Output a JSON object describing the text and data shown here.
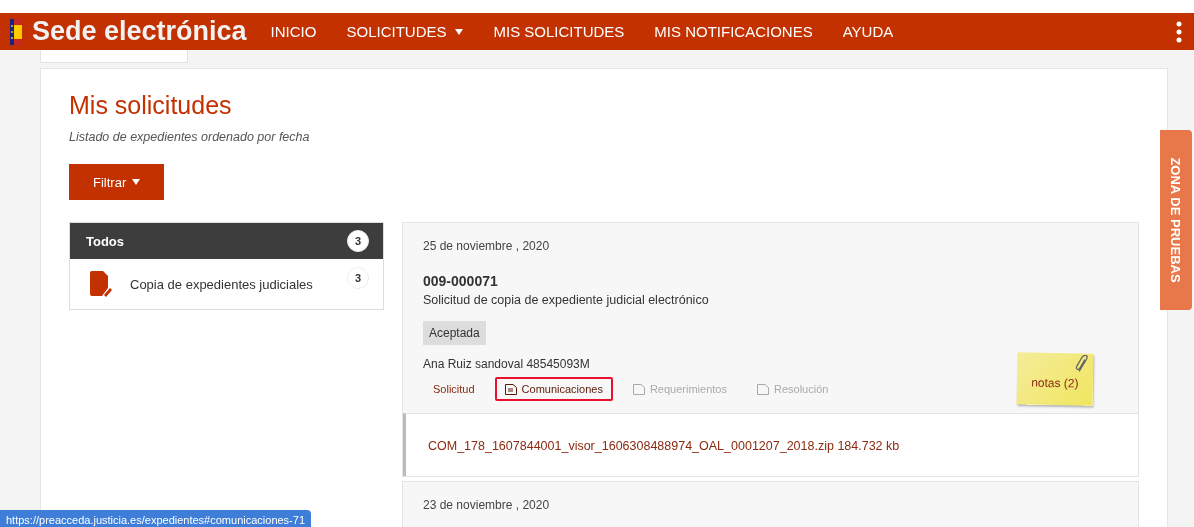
{
  "header": {
    "title": "Sede electrónica",
    "nav": [
      {
        "label": "INICIO",
        "dropdown": false
      },
      {
        "label": "SOLICITUDES",
        "dropdown": true
      },
      {
        "label": "MIS SOLICITUDES",
        "dropdown": false
      },
      {
        "label": "MIS NOTIFICACIONES",
        "dropdown": false
      },
      {
        "label": "AYUDA",
        "dropdown": false
      }
    ]
  },
  "page": {
    "title": "Mis solicitudes",
    "subtitle": "Listado de expedientes ordenado por fecha",
    "filter_button": "Filtrar"
  },
  "sidebar": {
    "items": [
      {
        "label": "Todos",
        "count": "3",
        "selected": true
      },
      {
        "label": "Copia de expedientes judiciales",
        "count": "3",
        "selected": false
      }
    ]
  },
  "records": [
    {
      "date": "25 de noviembre , 2020",
      "number": "009-000071",
      "description": "Solicitud de copia de expediente judicial electrónico",
      "status": "Aceptada",
      "applicant": "Ana Ruiz sandoval 48545093M",
      "notes": "notas (2)",
      "tabs": [
        {
          "label": "Solicitud",
          "icon": false,
          "selected": false,
          "disabled": false
        },
        {
          "label": "Comunicaciones",
          "icon": true,
          "selected": true,
          "disabled": false
        },
        {
          "label": "Requerimientos",
          "icon": true,
          "selected": false,
          "disabled": true
        },
        {
          "label": "Resolución",
          "icon": true,
          "selected": false,
          "disabled": true
        }
      ],
      "files": [
        "COM_178_1607844001_visor_1606308488974_OAL_0001207_2018.zip 184.732 kb"
      ]
    },
    {
      "date": "23 de noviembre , 2020"
    }
  ],
  "side_tab": "ZONA DE PRUEBAS",
  "status_url": "https://preacceda.justicia.es/expedientes#comunicaciones-71"
}
